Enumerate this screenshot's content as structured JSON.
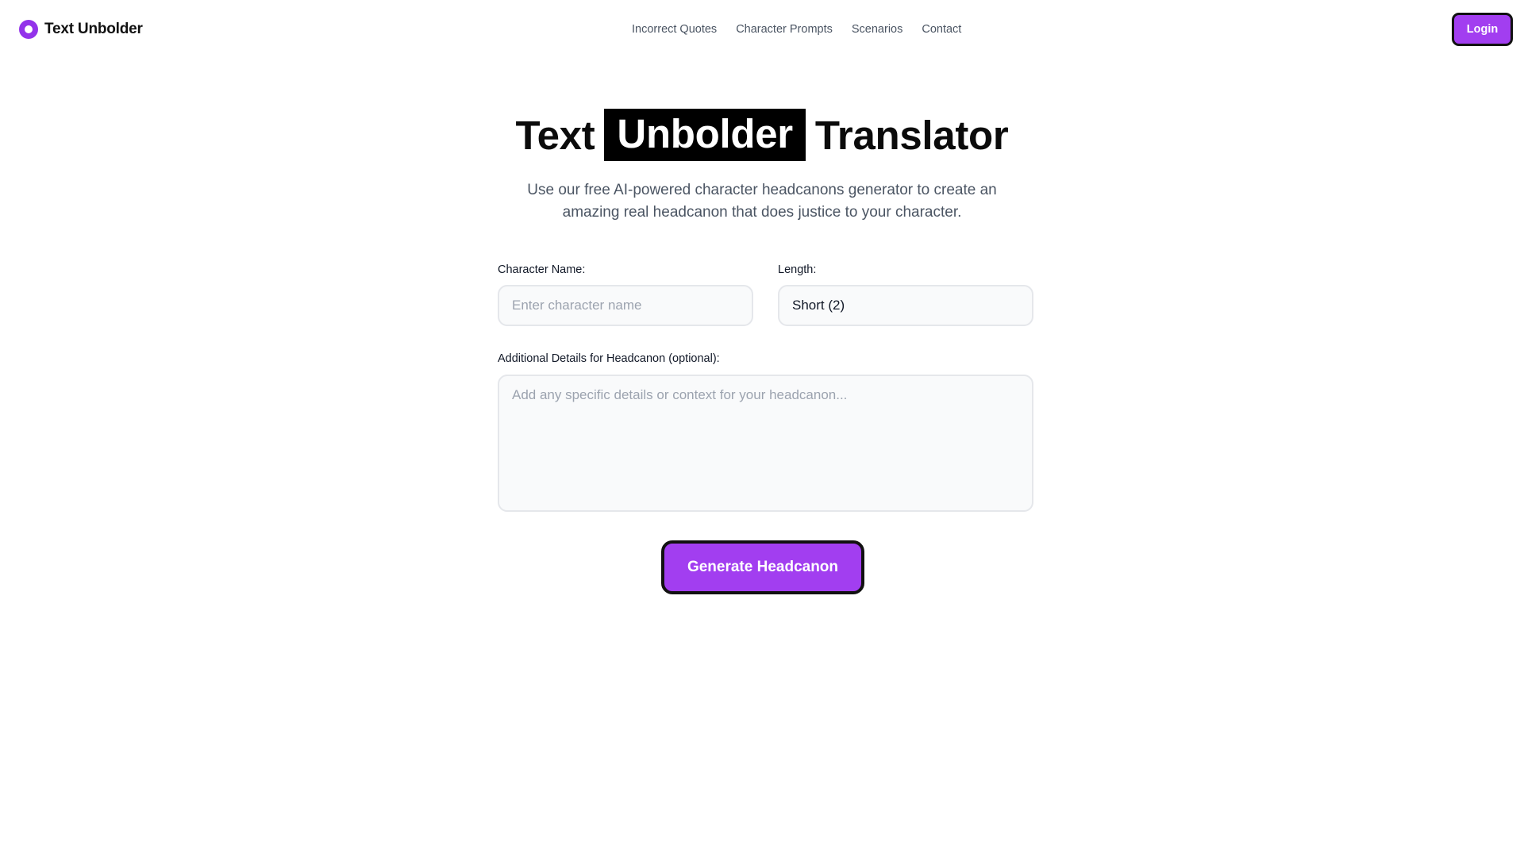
{
  "header": {
    "brand_name": "Text Unbolder",
    "brand_icon": "ring-logo-icon",
    "nav": [
      {
        "label": "Incorrect Quotes"
      },
      {
        "label": "Character Prompts"
      },
      {
        "label": "Scenarios"
      },
      {
        "label": "Contact"
      }
    ],
    "login_label": "Login"
  },
  "hero": {
    "title_before": "Text",
    "title_highlight": "Unbolder",
    "title_after": "Translator",
    "subtitle": "Use our free AI-powered character headcanons generator to create an amazing real headcanon that does justice to your character."
  },
  "form": {
    "character_name": {
      "label": "Character Name:",
      "value": "",
      "placeholder": "Enter character name"
    },
    "length": {
      "label": "Length:",
      "value": "Short (2)"
    },
    "details": {
      "label": "Additional Details for Headcanon (optional):",
      "value": "",
      "placeholder": "Add any specific details or context for your headcanon..."
    },
    "submit_label": "Generate Headcanon"
  },
  "colors": {
    "accent": "#a23ef0",
    "brand": "#9333ea",
    "border_dark": "#111111",
    "field_bg": "#f9fafb",
    "field_border": "#e5e7eb",
    "muted_text": "#4b5563"
  }
}
